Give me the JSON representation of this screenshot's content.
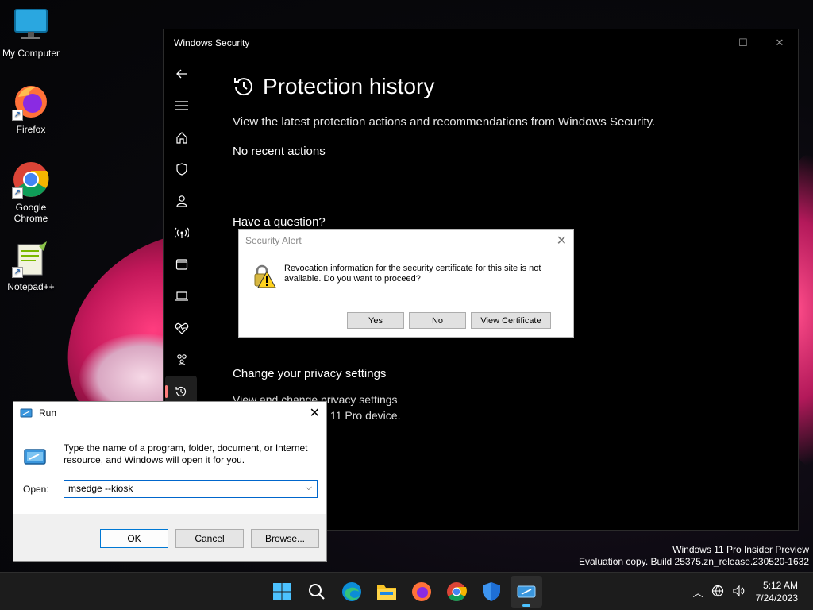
{
  "desktop": {
    "icons": [
      {
        "label": "My Computer"
      },
      {
        "label": "Firefox"
      },
      {
        "label": "Google Chrome"
      },
      {
        "label": "Notepad++"
      }
    ],
    "watermark_line1": "Windows 11 Pro Insider Preview",
    "watermark_line2": "Evaluation copy. Build 25375.zn_release.230520-1632"
  },
  "security_window": {
    "title": "Windows Security",
    "page_title": "Protection history",
    "description": "View the latest protection actions and recommendations from Windows Security.",
    "no_actions": "No recent actions",
    "question_heading": "Have a question?",
    "privacy_heading": "Change your privacy settings",
    "privacy_text_1": "View and change privacy settings",
    "privacy_text_2": "11 Pro device."
  },
  "security_alert": {
    "title": "Security Alert",
    "message": "Revocation information for the security certificate for this site is not available. Do you want to proceed?",
    "yes_label": "Yes",
    "no_label": "No",
    "view_cert_label": "View Certificate"
  },
  "run_dialog": {
    "title": "Run",
    "message": "Type the name of a program, folder, document, or Internet resource, and Windows will open it for you.",
    "open_label": "Open:",
    "input_value": "msedge --kiosk",
    "ok_label": "OK",
    "cancel_label": "Cancel",
    "browse_label": "Browse..."
  },
  "taskbar": {
    "time": "5:12 AM",
    "date": "7/24/2023"
  },
  "colors": {
    "accent": "#4cc2ff",
    "run_input_border": "#0066cc"
  }
}
